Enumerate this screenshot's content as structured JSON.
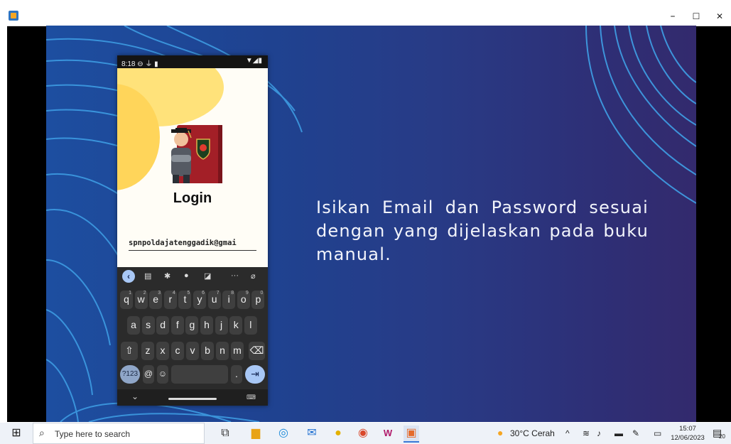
{
  "window": {
    "minimize": "–",
    "maximize": "☐",
    "close": "✕"
  },
  "slide": {
    "text": "Isikan Email dan Password sesuai dengan yang dijelaskan pada buku manual."
  },
  "phone": {
    "time": "8:18",
    "status_left_icons": "⊖ ⏚ ▮",
    "status_right_icons": "▼◢▮",
    "login_title": "Login",
    "email_value": "spnpoldajatenggadik@gmai"
  },
  "keyboard": {
    "row1": [
      [
        "q",
        "1"
      ],
      [
        "w",
        "2"
      ],
      [
        "e",
        "3"
      ],
      [
        "r",
        "4"
      ],
      [
        "t",
        "5"
      ],
      [
        "y",
        "6"
      ],
      [
        "u",
        "7"
      ],
      [
        "i",
        "8"
      ],
      [
        "o",
        "9"
      ],
      [
        "p",
        "0"
      ]
    ],
    "row2": [
      "a",
      "s",
      "d",
      "f",
      "g",
      "h",
      "j",
      "k",
      "l"
    ],
    "row3": [
      "z",
      "x",
      "c",
      "v",
      "b",
      "n",
      "m"
    ],
    "key_123": "?123",
    "key_at": "@",
    "key_dot": ".",
    "tool_more": "···"
  },
  "taskbar": {
    "search_placeholder": "Type here to search",
    "weather": "30°C Cerah",
    "time": "15:07",
    "date": "12/06/2023",
    "notif_count": "20"
  },
  "colors": {
    "slide_left": "#1d4ea0",
    "slide_right": "#332a6d",
    "wave": "#3fa0e6",
    "key": "#3f3f3f"
  }
}
